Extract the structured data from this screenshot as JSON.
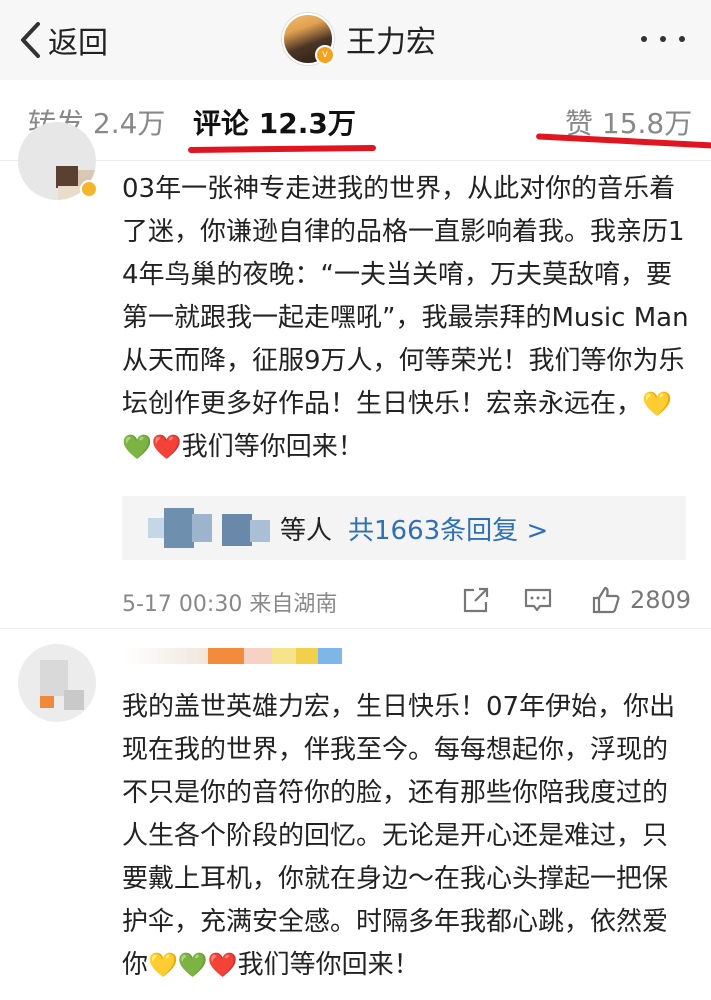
{
  "navbar": {
    "back_label": "返回",
    "title": "王力宏"
  },
  "tabs": {
    "repost": "转发 2.4万",
    "comments": "评论 12.3万",
    "likes": "赞 15.8万"
  },
  "comments": [
    {
      "text": "03年一张神专走进我的世界，从此对你的音乐着了迷，你谦逊自律的品格一直影响着我。我亲历14年鸟巢的夜晚：“一夫当关唷，万夫莫敌唷，要第一就跟我一起走嘿吼”，我最崇拜的Music Man从天而降，征服9万人，何等荣光！我们等你为乐坛创作更多好作品！生日快乐！宏亲永远在，",
      "emojis": "💛💚❤️",
      "text_end": "我们等你回来！",
      "reply_people": "等人",
      "reply_count": "共1663条回复 >",
      "time": "5-17 00:30 来自湖南",
      "likes": "2809"
    },
    {
      "text": "我的盖世英雄力宏，生日快乐！07年伊始，你出现在我的世界，伴我至今。每每想起你，浮现的不只是你的音符你的脸，还有那些你陪我度过的人生各个阶段的回忆。无论是开心还是难过，只要戴上耳机，你就在身边～在我心头撑起一把保护伞，充满安全感。时隔多年我都心跳，依然爱你",
      "emojis": "💛💚❤️",
      "text_end": "我们等你回来！"
    }
  ],
  "colors": {
    "link": "#2e6fb7",
    "annotation": "#e0151f",
    "verified": "#f4a21f"
  }
}
